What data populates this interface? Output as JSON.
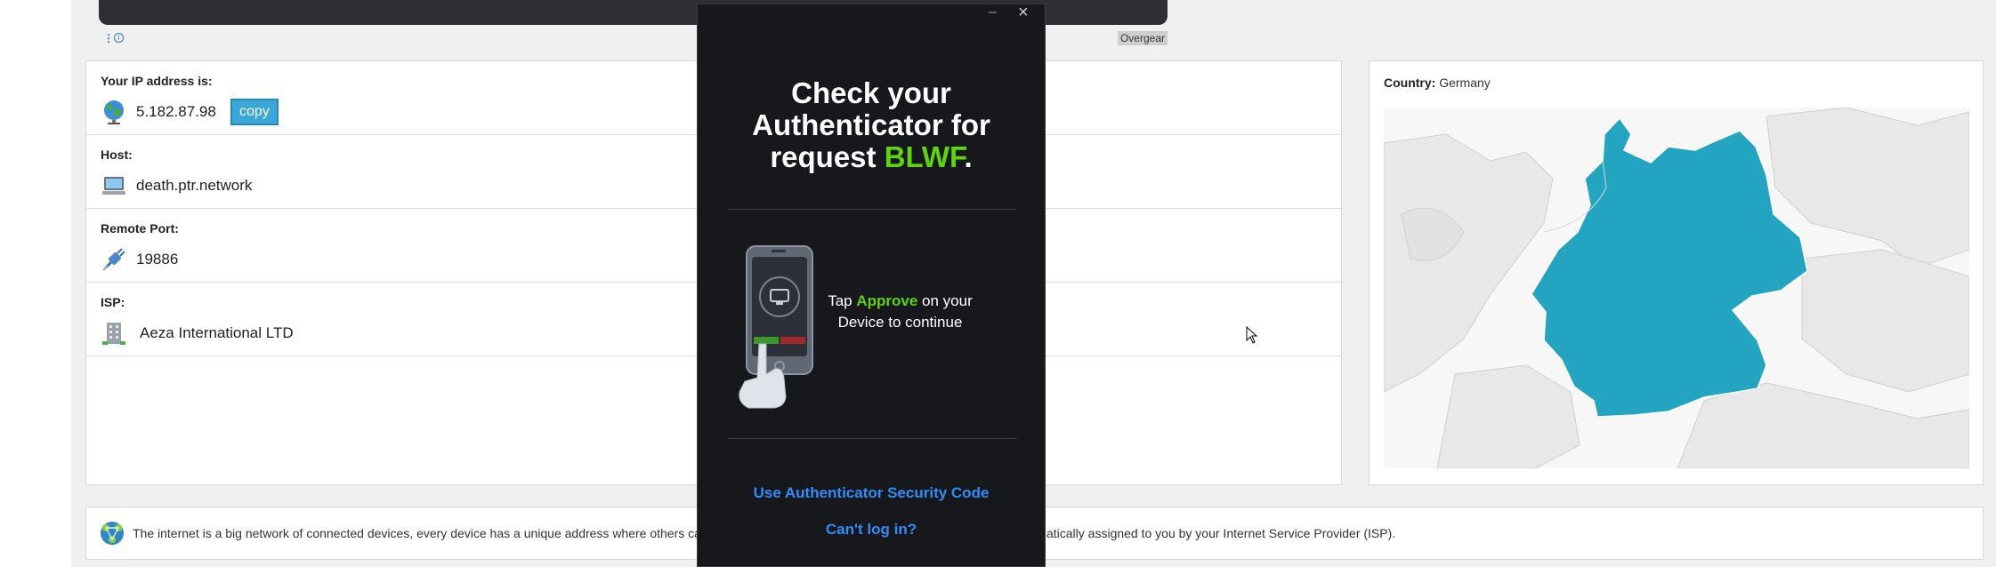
{
  "ad": {
    "dots": "⋮",
    "info": "i",
    "label": "Overgear"
  },
  "ip_info": {
    "ip_label": "Your IP address is:",
    "ip_value": "5.182.87.98",
    "copy_label": "copy",
    "host_label": "Host:",
    "host_value": "death.ptr.network",
    "port_label": "Remote Port:",
    "port_value": "19886",
    "isp_label": "ISP:",
    "isp_value": "Aeza International LTD"
  },
  "map": {
    "country_label": "Country:",
    "country_value": "Germany",
    "highlight_color": "#23a4c1"
  },
  "footer": {
    "text": "The internet is a big network of connected devices, every device has a unique address where others can find it, this unique identifier is your IP address and it is automatically assigned to you by your Internet Service Provider (ISP)."
  },
  "auth_popup": {
    "minimize_glyph": "–",
    "close_glyph": "×",
    "title_line1": "Check your",
    "title_line2": "Authenticator for",
    "title_line3_prefix": "request ",
    "request_code": "BLWF",
    "title_suffix": ".",
    "tap_prefix": "Tap ",
    "approve_word": "Approve",
    "tap_suffix": " on your Device to continue",
    "security_code_link": "Use Authenticator Security Code",
    "cant_login_link": "Can't log in?",
    "accent_color": "#5ed40b",
    "link_color": "#2e8dfb"
  }
}
